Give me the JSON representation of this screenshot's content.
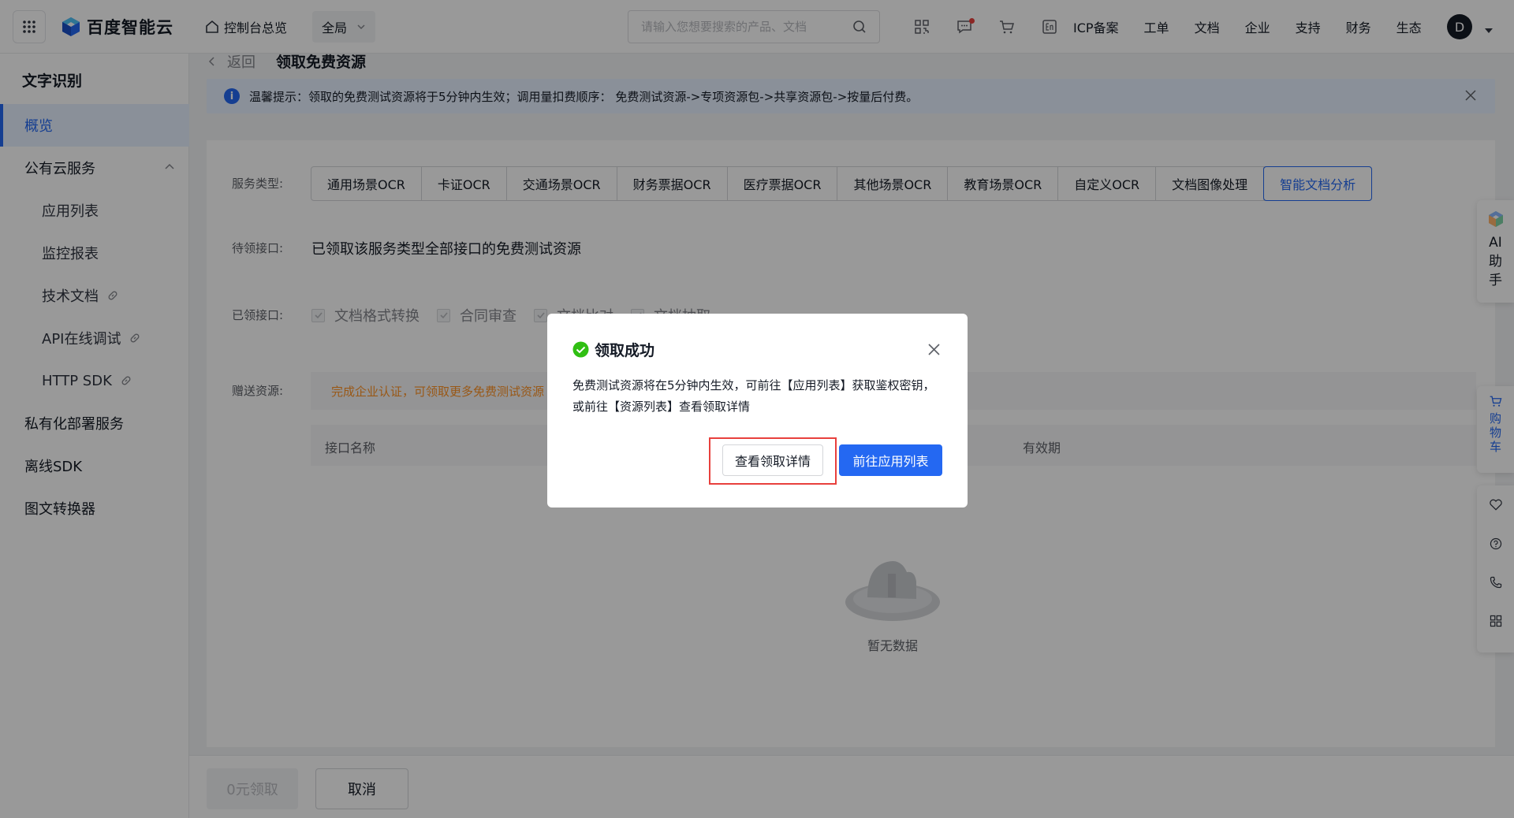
{
  "topbar": {
    "brand": "百度智能云",
    "console_home": "控制台总览",
    "region": "全局",
    "search_placeholder": "请输入您想要搜索的产品、文档",
    "links": [
      "ICP备案",
      "工单",
      "文档",
      "企业",
      "支持",
      "财务",
      "生态"
    ],
    "avatar_letter": "D"
  },
  "sidebar": {
    "title": "文字识别",
    "items": [
      {
        "label": "概览",
        "active": true
      },
      {
        "label": "公有云服务",
        "expanded": true
      },
      {
        "label": "应用列表"
      },
      {
        "label": "监控报表"
      },
      {
        "label": "技术文档"
      },
      {
        "label": "API在线调试"
      },
      {
        "label": "HTTP SDK"
      },
      {
        "label": "私有化部署服务"
      },
      {
        "label": "离线SDK"
      },
      {
        "label": "图文转换器"
      }
    ]
  },
  "breadcrumb": {
    "back": "返回",
    "title": "领取免费资源"
  },
  "notice": {
    "text": "温馨提示：领取的免费测试资源将于5分钟内生效；调用量扣费顺序： 免费测试资源->专项资源包->共享资源包->按量后付费。"
  },
  "form": {
    "service_type_label": "服务类型:",
    "tabs": [
      "通用场景OCR",
      "卡证OCR",
      "交通场景OCR",
      "财务票据OCR",
      "医疗票据OCR",
      "其他场景OCR",
      "教育场景OCR",
      "自定义OCR",
      "文档图像处理",
      "智能文档分析"
    ],
    "selected_tab": "智能文档分析",
    "pending_label": "待领接口:",
    "pending_text": "已领取该服务类型全部接口的免费测试资源",
    "claimed_label": "已领接口:",
    "claimed_items": [
      "文档格式转换",
      "合同审查",
      "文档比对",
      "文档抽取"
    ],
    "gift_label": "赠送资源:",
    "gift_text": "完成企业认证，可领取更多免费测试资源",
    "table_headers": [
      "接口名称",
      "有效期"
    ],
    "empty_text": "暂无数据"
  },
  "bottom": {
    "free_claim": "0元领取",
    "cancel": "取消"
  },
  "float_tools": {
    "ai_helper": "AI助手",
    "ai_chars": [
      "AI",
      "助",
      "手"
    ],
    "cart_chars": [
      "购",
      "物",
      "车"
    ]
  },
  "dialog": {
    "title": "领取成功",
    "body": "免费测试资源将在5分钟内生效，可前往【应用列表】获取鉴权密钥，或前往【资源列表】查看领取详情",
    "btn_detail": "查看领取详情",
    "btn_go": "前往应用列表"
  },
  "colors": {
    "primary": "#2468f2",
    "success": "#30bf13",
    "warning": "#ff9326",
    "highlight": "#e8403d"
  }
}
